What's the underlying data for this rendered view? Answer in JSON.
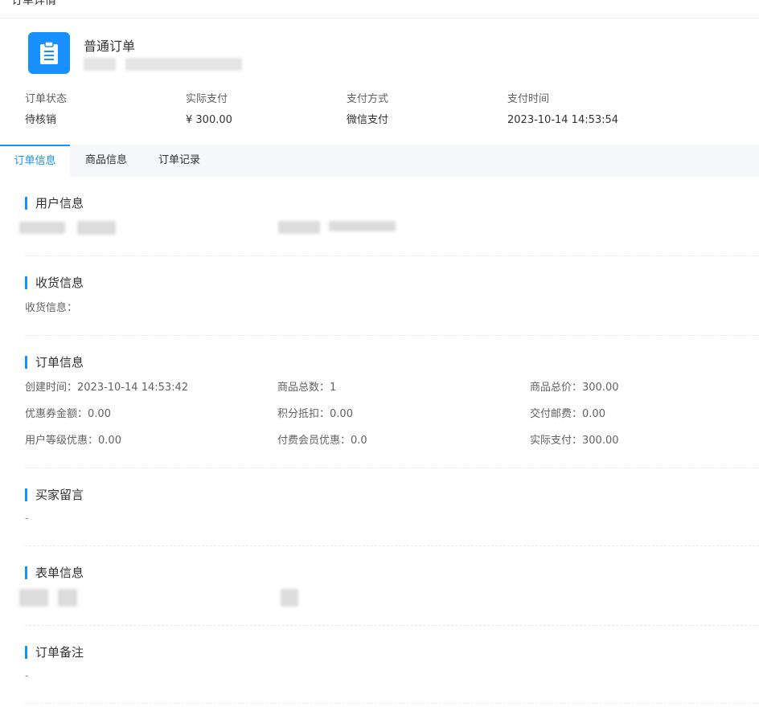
{
  "page": {
    "title": "订单详情"
  },
  "order": {
    "type_label": "普通订单",
    "icon": "clipboard-icon",
    "summary": [
      {
        "label": "订单状态",
        "value": "待核销"
      },
      {
        "label": "实际支付",
        "value": "¥ 300.00"
      },
      {
        "label": "支付方式",
        "value": "微信支付"
      },
      {
        "label": "支付时间",
        "value": "2023-10-14 14:53:54"
      }
    ]
  },
  "tabs": [
    {
      "label": "订单信息",
      "active": true
    },
    {
      "label": "商品信息",
      "active": false
    },
    {
      "label": "订单记录",
      "active": false
    }
  ],
  "sections": {
    "user": {
      "title": "用户信息"
    },
    "shipping": {
      "title": "收货信息",
      "label": "收货信息：",
      "value": ""
    },
    "order_info": {
      "title": "订单信息",
      "fields": [
        {
          "k": "创建时间：",
          "v": "2023-10-14 14:53:42"
        },
        {
          "k": "商品总数：",
          "v": "1"
        },
        {
          "k": "商品总价：",
          "v": "300.00"
        },
        {
          "k": "优惠券金额：",
          "v": "0.00"
        },
        {
          "k": "积分抵扣：",
          "v": "0.00"
        },
        {
          "k": "交付邮费：",
          "v": "0.00"
        },
        {
          "k": "用户等级优惠：",
          "v": "0.00"
        },
        {
          "k": "付费会员优惠：",
          "v": "0.0"
        },
        {
          "k": "实际支付：",
          "v": "300.00"
        }
      ]
    },
    "buyer_note": {
      "title": "买家留言",
      "value": "-"
    },
    "form_info": {
      "title": "表单信息"
    },
    "order_remark": {
      "title": "订单备注",
      "value": "-"
    }
  },
  "colors": {
    "accent": "#1890ff",
    "tab_bg": "#f5f7fa",
    "text": "#303133",
    "muted": "#606266"
  }
}
